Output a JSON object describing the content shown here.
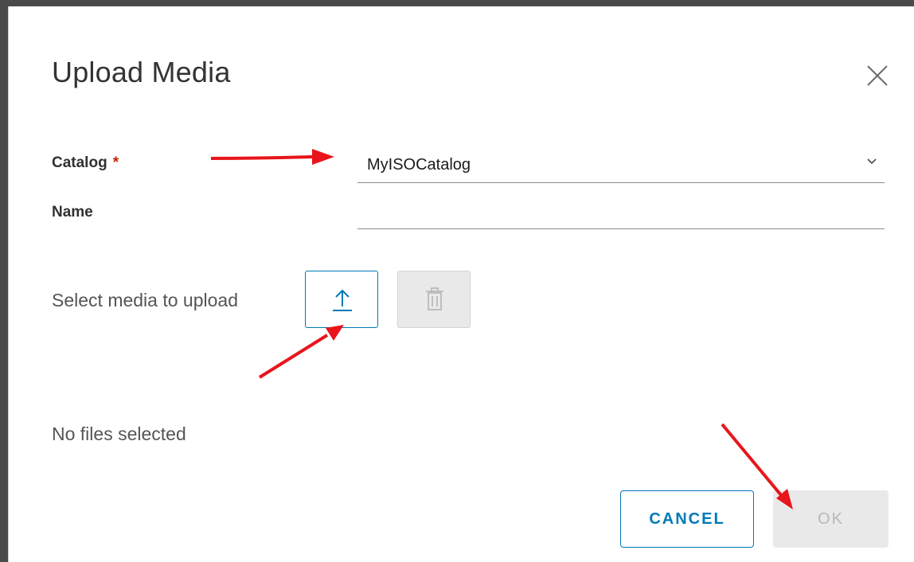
{
  "dialog": {
    "title": "Upload Media",
    "close_icon": "close-icon"
  },
  "form": {
    "catalog": {
      "label": "Catalog",
      "required_marker": "*",
      "selected_value": "MyISOCatalog",
      "caret_icon": "chevron-down-icon"
    },
    "name": {
      "label": "Name",
      "value": "",
      "placeholder": ""
    }
  },
  "media": {
    "label": "Select media to upload",
    "upload_icon": "upload-arrow-icon",
    "delete_icon": "trash-icon",
    "status": "No files selected"
  },
  "footer": {
    "cancel_label": "CANCEL",
    "ok_label": "OK"
  },
  "colors": {
    "accent": "#0079b8",
    "required": "#c92100",
    "disabled_bg": "#e9e9e9",
    "annotation_arrow": "#e8151b",
    "backdrop": "#4a4a4a"
  }
}
